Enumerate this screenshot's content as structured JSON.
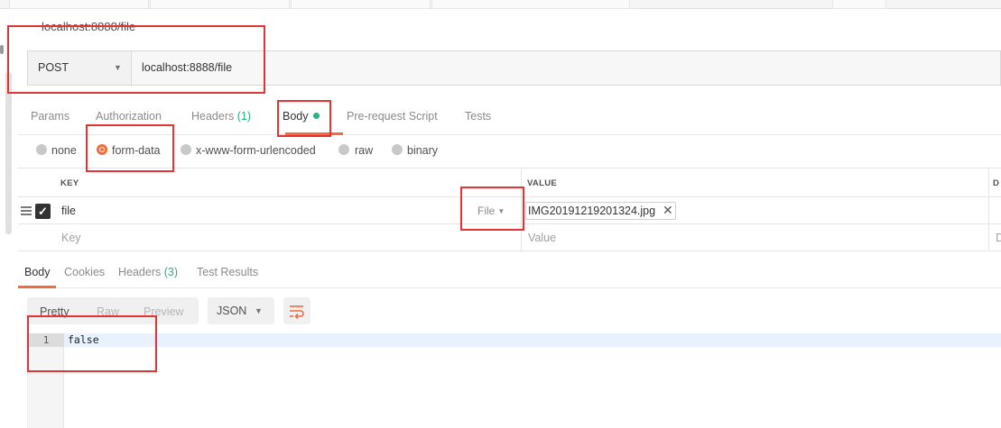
{
  "request": {
    "name": "localhost:8888/file",
    "method": "POST",
    "url": "localhost:8888/file"
  },
  "request_tabs": [
    {
      "label": "Params",
      "count": ""
    },
    {
      "label": "Authorization",
      "count": ""
    },
    {
      "label": "Headers",
      "count": "(1)"
    },
    {
      "label": "Body",
      "count": ""
    },
    {
      "label": "Pre-request Script",
      "count": ""
    },
    {
      "label": "Tests",
      "count": ""
    }
  ],
  "body_types": [
    "none",
    "form-data",
    "x-www-form-urlencoded",
    "raw",
    "binary"
  ],
  "selected_body_type": "form-data",
  "form_table": {
    "headers": [
      "KEY",
      "VALUE",
      "D"
    ],
    "rows": [
      {
        "key": "file",
        "type": "File",
        "value": "IMG20191219201324.jpg",
        "remove": "✕",
        "checked": true
      }
    ],
    "placeholders": {
      "key": "Key",
      "value": "Value",
      "desc": "D"
    }
  },
  "response_tabs": [
    {
      "label": "Body",
      "count": ""
    },
    {
      "label": "Cookies",
      "count": ""
    },
    {
      "label": "Headers",
      "count": "(3)"
    },
    {
      "label": "Test Results",
      "count": ""
    }
  ],
  "response_toolbar": {
    "views": [
      "Pretty",
      "Raw",
      "Preview"
    ],
    "format": "JSON"
  },
  "response_body": {
    "line_number": "1",
    "text": "false"
  },
  "colors": {
    "accent": "#f26b3a",
    "count_green": "#26b47f",
    "annotation_red": "#e53333"
  }
}
